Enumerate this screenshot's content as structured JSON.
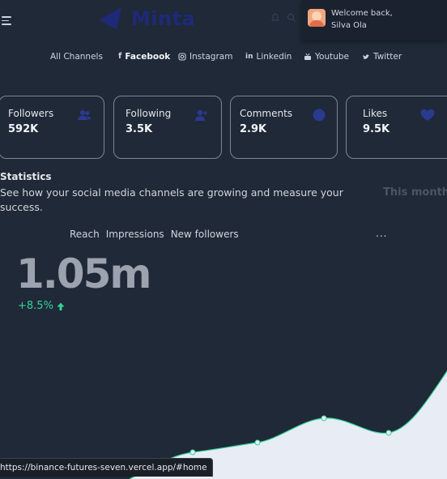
{
  "header": {
    "brand": "Minta",
    "welcome_line1": "Welcome back,",
    "welcome_line2": "Silva Ola",
    "icons": [
      "menu-icon",
      "bell-icon",
      "search-icon"
    ]
  },
  "channels": [
    {
      "label": "All Channels",
      "icon": ""
    },
    {
      "label": "Facebook",
      "icon": "f",
      "active": true
    },
    {
      "label": "Instagram",
      "icon": "◎"
    },
    {
      "label": "Linkedin",
      "icon": "in"
    },
    {
      "label": "Youtube",
      "icon": "▣"
    },
    {
      "label": "Twitter",
      "icon": "🕊"
    }
  ],
  "cards": [
    {
      "label": "Followers",
      "value": "592K",
      "icon": "users-icon"
    },
    {
      "label": "Following",
      "value": "3.5K",
      "icon": "user-plus-icon"
    },
    {
      "label": "Comments",
      "value": "2.9K",
      "icon": "comment-icon"
    },
    {
      "label": "Likes",
      "value": "9.5K",
      "icon": "heart-icon"
    }
  ],
  "statistics": {
    "title": "Statistics",
    "subtitle": "See how your social media channels are growing and measure your success.",
    "period": "This month"
  },
  "metric_tabs": [
    "Reach",
    "Impressions",
    "New followers"
  ],
  "more_label": "...",
  "reach": {
    "value": "1.05m",
    "growth": "+8.5%"
  },
  "colors": {
    "background": "#1f2938",
    "accent": "#1e2a78",
    "growth": "#34d399",
    "card_border": "#7b8595"
  },
  "status_url": "https://binance-futures-seven.vercel.app/#home"
}
